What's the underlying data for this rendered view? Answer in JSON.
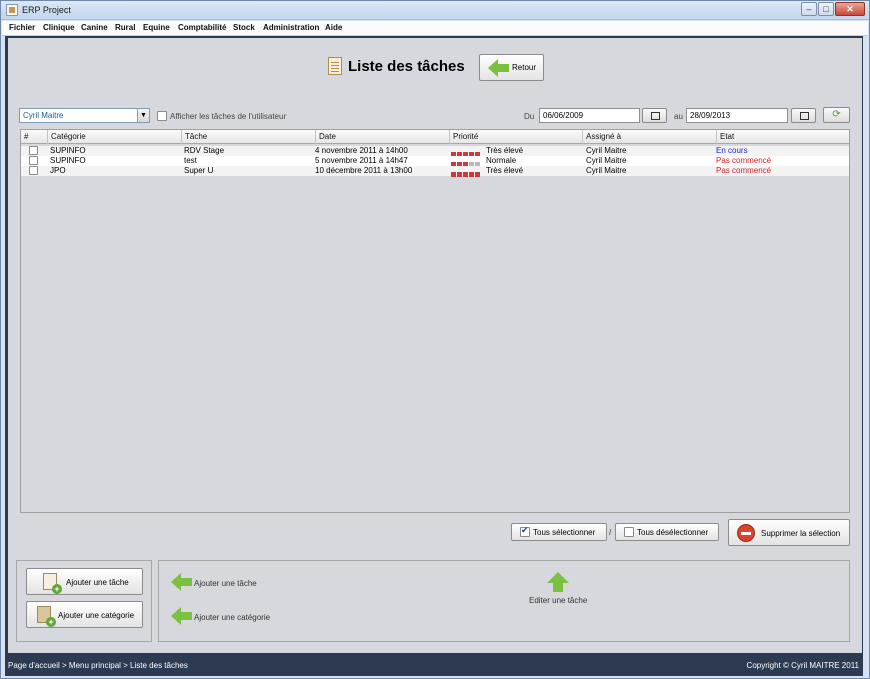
{
  "window": {
    "title": "ERP Project",
    "min": "–",
    "max": "□",
    "close": "✕"
  },
  "menu": [
    "Fichier",
    "Clinique",
    "Canine",
    "Rural",
    "Equine",
    "Comptabilité",
    "Stock",
    "Administration",
    "Aide"
  ],
  "header": {
    "title": "Liste des tâches",
    "back_label": "Retour"
  },
  "filter": {
    "user": "Cyril Maitre",
    "show_user_tasks_label": "Afficher les tâches de l'utilisateur",
    "from_label": "Du",
    "from_date": "06/06/2009",
    "to_label": "au",
    "to_date": "28/09/2013"
  },
  "table": {
    "columns": [
      "#",
      "Catégorie",
      "Tâche",
      "Date",
      "Priorité",
      "Assigné à",
      "Etat"
    ],
    "rows": [
      {
        "categorie": "SUPINFO",
        "tache": "RDV Stage",
        "date": "4 novembre 2011 à 14h00",
        "priorite": "Très élevé",
        "priorite_level": 5,
        "assigne": "Cyril Maitre",
        "etat": "En cours",
        "etat_color": "#2222cc"
      },
      {
        "categorie": "SUPINFO",
        "tache": "test",
        "date": "5 novembre 2011 à 14h47",
        "priorite": "Normale",
        "priorite_level": 3,
        "assigne": "Cyril Maitre",
        "etat": "Pas commencé",
        "etat_color": "#d42020"
      },
      {
        "categorie": "JPO",
        "tache": "Super U",
        "date": "10 décembre 2011 à 13h00",
        "priorite": "Très élevé",
        "priorite_level": 5,
        "assigne": "Cyril Maitre",
        "etat": "Pas commencé",
        "etat_color": "#d42020"
      }
    ]
  },
  "actions": {
    "select_all": "Tous sélectionner",
    "separator": "/",
    "deselect_all": "Tous désélectionner",
    "delete_selection": "Supprimer la sélection"
  },
  "bottom": {
    "add_task": "Ajouter une tâche",
    "add_category": "Ajouter une catégorie",
    "help_add_task": "Ajouter une tâche",
    "help_add_category": "Ajouter une catégorie",
    "help_edit_task": "Editer une tâche"
  },
  "status": {
    "breadcrumb": "Page d'accueil > Menu principal > Liste des tâches",
    "copyright": "Copyright © Cyril MAITRE 2011"
  }
}
